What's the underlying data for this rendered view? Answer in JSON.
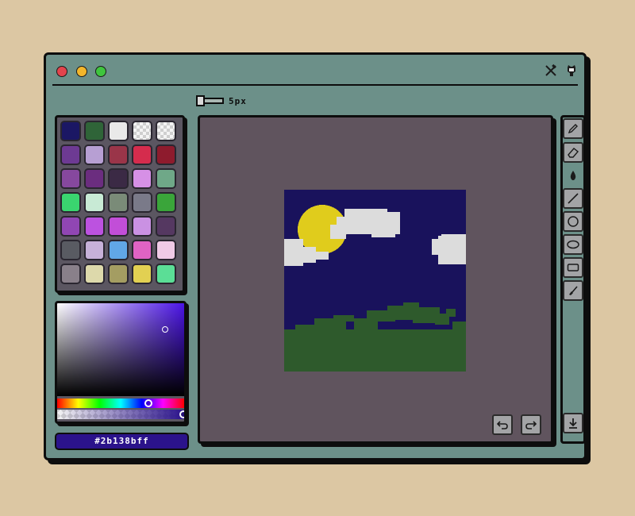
{
  "window": {
    "controls": [
      "close-dot",
      "minimize-dot",
      "maximize-dot"
    ],
    "top_right_icons": [
      "tools-icon",
      "github-icon"
    ]
  },
  "brush": {
    "size_label": "5px"
  },
  "palette": {
    "rows": [
      [
        "#1b1764",
        "#2f6438",
        "#e9e9e9",
        "alpha",
        "alpha"
      ],
      [
        "#6d3a93",
        "#b79fd3",
        "#9a3549",
        "#d52c4d",
        "#8e1b2d"
      ],
      [
        "#86489e",
        "#6b2d7f",
        "#3b2a45",
        "#d690e6",
        "#6fa888"
      ],
      [
        "#3ad56f",
        "#c8ead5",
        "#7a8b78",
        "#7a7a89",
        "#3aa53a"
      ],
      [
        "#9046b3",
        "#bc52e0",
        "#c24ed8",
        "#ca91e3",
        "#553861"
      ],
      [
        "#595b62",
        "#c7b1d9",
        "#61a7e6",
        "#e063c4",
        "#f0cae6"
      ],
      [
        "#89808a",
        "#ddd9ab",
        "#a49d62",
        "#e2d052",
        "#5bde96"
      ]
    ]
  },
  "color_picker": {
    "hue_color": "#4b14e6",
    "saturation": 0.85,
    "value": 0.72,
    "hue_position": 0.72,
    "alpha_position": 1.0
  },
  "hex_value": "#2b138bff",
  "canvas": {
    "sky_color": "#19125c",
    "sun_color": "#e0cc1c",
    "cloud_color": "#dcdcdc",
    "grass_color": "#2e5a2c"
  },
  "toolbar": {
    "tools": [
      "pencil-icon",
      "eraser-icon",
      "fill-icon",
      "line-icon",
      "circle-icon",
      "ellipse-icon",
      "rectangle-icon",
      "brush-icon"
    ],
    "active_tool": "fill-icon"
  },
  "actions": [
    "undo-icon",
    "redo-icon",
    "download-icon"
  ]
}
